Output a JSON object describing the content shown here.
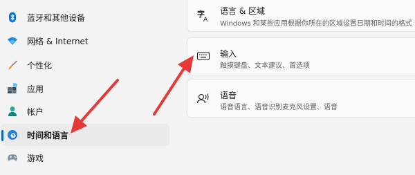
{
  "sidebar": {
    "items": [
      {
        "label": "蓝牙和其他设备",
        "icon": "bluetooth-icon"
      },
      {
        "label": "网络 & Internet",
        "icon": "wifi-icon"
      },
      {
        "label": "个性化",
        "icon": "brush-icon"
      },
      {
        "label": "应用",
        "icon": "apps-icon"
      },
      {
        "label": "帐户",
        "icon": "person-icon"
      },
      {
        "label": "时间和语言",
        "icon": "clock-globe-icon",
        "selected": true
      },
      {
        "label": "游戏",
        "icon": "gamepad-icon"
      }
    ]
  },
  "main": {
    "cards": [
      {
        "title": "语言 & 区域",
        "subtitle": "Windows 和某些应用根据你所在的区域设置日期和时间的格式",
        "icon": "language-region-icon"
      },
      {
        "title": "输入",
        "subtitle": "触摸键盘、文本建议、首选项",
        "icon": "keyboard-icon"
      },
      {
        "title": "语音",
        "subtitle": "语音语言、语音识别麦克风设置、语音",
        "icon": "speech-icon"
      }
    ]
  },
  "colors": {
    "accent": "#0067c0",
    "annotation_arrow": "#e53935",
    "card_background": "#fbfbfb",
    "page_background": "#f3f3f3"
  }
}
